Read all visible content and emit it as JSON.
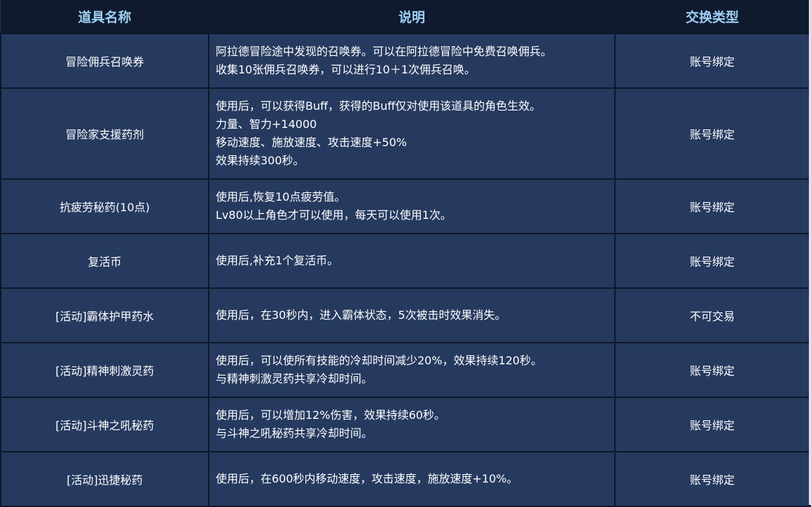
{
  "header": {
    "col_name": "道具名称",
    "col_desc": "说明",
    "col_type": "交换类型"
  },
  "rows": [
    {
      "name": "冒险佣兵召唤券",
      "desc": [
        "阿拉德冒险途中发现的召唤券。可以在阿拉德冒险中免费召唤佣兵。",
        "收集10张佣兵召唤券，可以进行10＋1次佣兵召唤。"
      ],
      "type": "账号绑定"
    },
    {
      "name": "冒险家支援药剂",
      "desc": [
        "使用后，可以获得Buff，获得的Buff仅对使用该道具的角色生效。",
        "力量、智力+14000",
        "移动速度、施放速度、攻击速度+50%",
        "效果持续300秒。"
      ],
      "type": "账号绑定"
    },
    {
      "name": "抗疲劳秘药(10点)",
      "desc": [
        "使用后,恢复10点疲劳值。",
        "Lv80以上角色才可以使用，每天可以使用1次。"
      ],
      "type": "账号绑定"
    },
    {
      "name": "复活币",
      "desc": [
        "使用后,补充1个复活币。"
      ],
      "type": "账号绑定"
    },
    {
      "name": "[活动]霸体护甲药水",
      "desc": [
        "使用后，在30秒内，进入霸体状态，5次被击时效果消失。"
      ],
      "type": "不可交易"
    },
    {
      "name": "[活动]精神刺激灵药",
      "desc": [
        "使用后，可以使所有技能的冷却时间减少20%，效果持续120秒。",
        "与精神刺激灵药共享冷却时间。"
      ],
      "type": "账号绑定"
    },
    {
      "name": "[活动]斗神之吼秘药",
      "desc": [
        "使用后，可以增加12%伤害，效果持续60秒。",
        "与斗神之吼秘药共享冷却时间。"
      ],
      "type": "账号绑定"
    },
    {
      "name": "[活动]迅捷秘药",
      "desc": [
        "使用后，在600秒内移动速度，攻击速度，施放速度+10%。"
      ],
      "type": "账号绑定"
    }
  ]
}
